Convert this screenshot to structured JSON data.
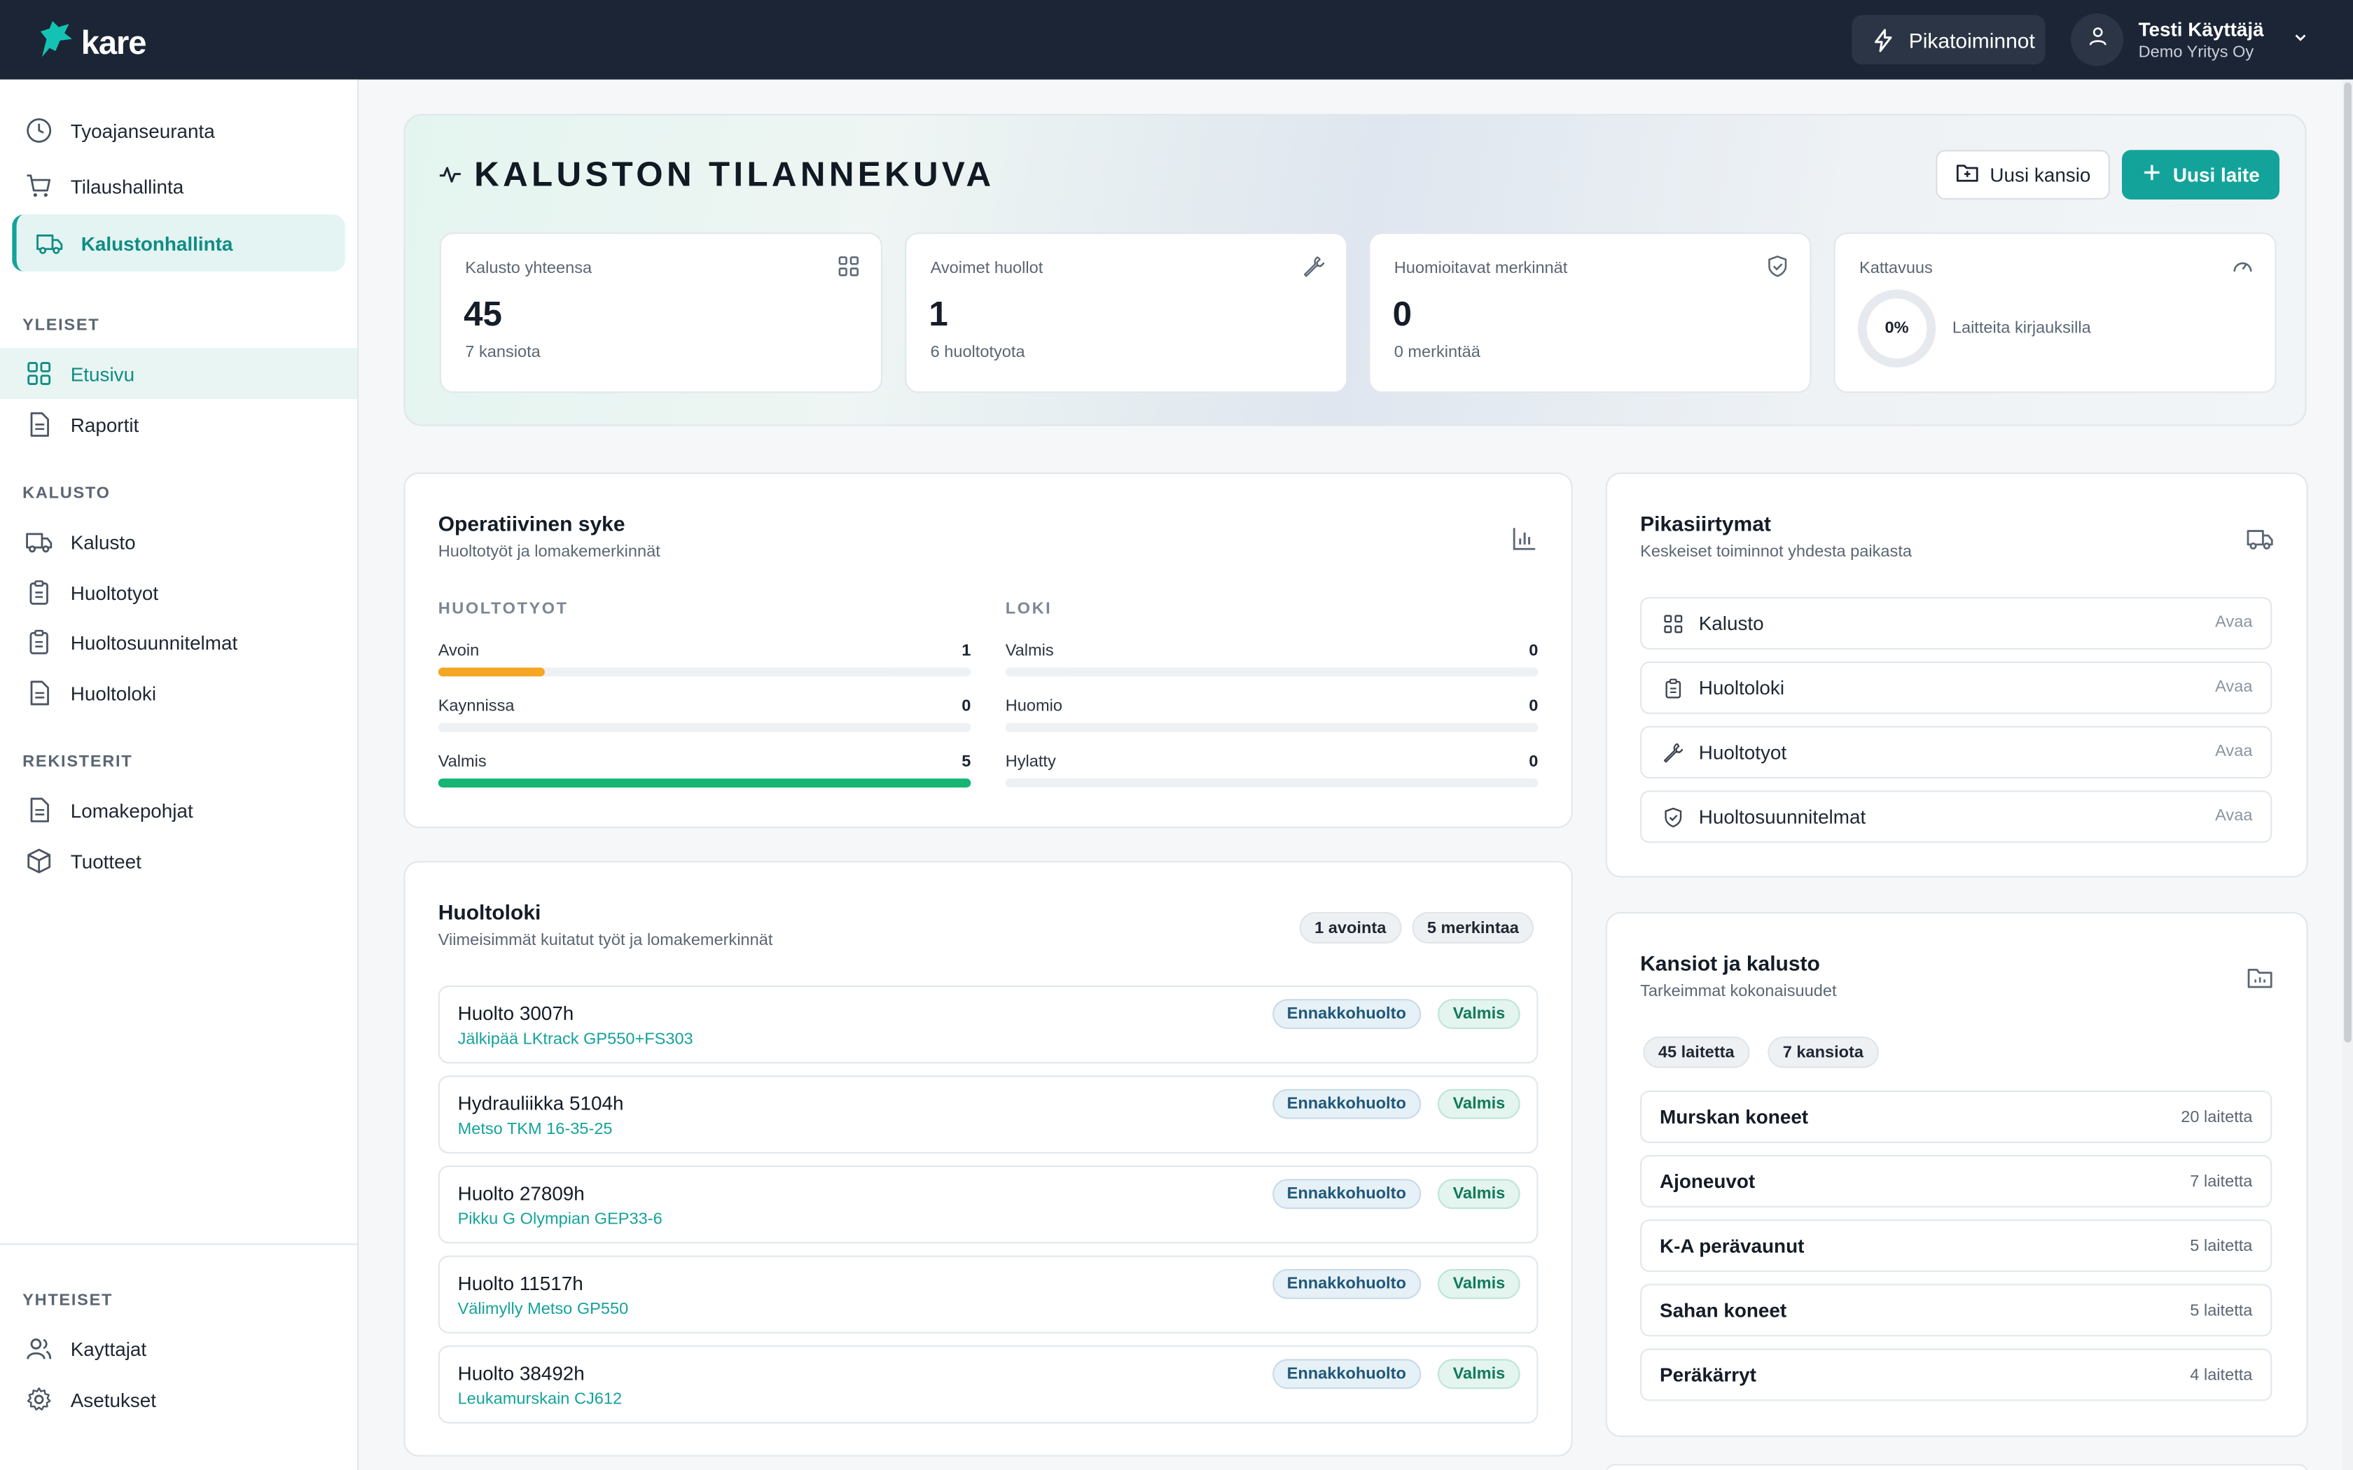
{
  "app": {
    "brand": "kare",
    "quick_actions": "Pikatoiminnot",
    "user": {
      "name": "Testi Käyttäjä",
      "org": "Demo Yritys Oy"
    }
  },
  "sidebar": {
    "top_items": [
      {
        "label": "Tyoajanseuranta",
        "icon": "clock-icon"
      },
      {
        "label": "Tilaushallinta",
        "icon": "cart-icon"
      },
      {
        "label": "Kalustonhallinta",
        "icon": "truck-icon"
      }
    ],
    "section_yleiset": "YLEISET",
    "yleiset": [
      {
        "label": "Etusivu",
        "icon": "grid-icon"
      },
      {
        "label": "Raportit",
        "icon": "document-icon"
      }
    ],
    "section_kalusto": "KALUSTO",
    "kalusto": [
      {
        "label": "Kalusto",
        "icon": "truck-icon"
      },
      {
        "label": "Huoltotyot",
        "icon": "clipboard-icon"
      },
      {
        "label": "Huoltosuunnitelmat",
        "icon": "clipboard-icon"
      },
      {
        "label": "Huoltoloki",
        "icon": "document-icon"
      }
    ],
    "section_rekisterit": "REKISTERIT",
    "rekisterit": [
      {
        "label": "Lomakepohjat",
        "icon": "document-icon"
      },
      {
        "label": "Tuotteet",
        "icon": "box-icon"
      }
    ],
    "section_yhteiset": "YHTEISET",
    "yhteiset": [
      {
        "label": "Kayttajat",
        "icon": "users-icon"
      },
      {
        "label": "Asetukset",
        "icon": "gear-icon"
      }
    ]
  },
  "hero": {
    "title": "KALUSTON TILANNEKUVA",
    "btn_folder": "Uusi kansio",
    "btn_device": "Uusi laite",
    "stats": [
      {
        "label": "Kalusto yhteensa",
        "value": "45",
        "sub": "7 kansiota"
      },
      {
        "label": "Avoimet huollot",
        "value": "1",
        "sub": "6 huoltotyota"
      },
      {
        "label": "Huomioitavat merkinnät",
        "value": "0",
        "sub": "0 merkintää"
      },
      {
        "label": "Kattavuus",
        "value": "0%",
        "sub": "Laitteita kirjauksilla",
        "percent": 0
      }
    ]
  },
  "pulse": {
    "title": "Operatiivinen syke",
    "subtitle": "Huoltotyöt ja lomakemerkinnät",
    "col1_head": "HUOLTOTYOT",
    "col1": [
      {
        "label": "Avoin",
        "value": "1",
        "fraction": 0.2,
        "color": "#f5a623"
      },
      {
        "label": "Kaynnissa",
        "value": "0",
        "fraction": 0,
        "color": "#14a39a"
      },
      {
        "label": "Valmis",
        "value": "5",
        "fraction": 1.0,
        "color": "#15b574"
      }
    ],
    "col2_head": "LOKI",
    "col2": [
      {
        "label": "Valmis",
        "value": "0",
        "fraction": 0,
        "color": "#15b574"
      },
      {
        "label": "Huomio",
        "value": "0",
        "fraction": 0,
        "color": "#f5a623"
      },
      {
        "label": "Hylatty",
        "value": "0",
        "fraction": 0,
        "color": "#e0524c"
      }
    ]
  },
  "log": {
    "title": "Huoltoloki",
    "subtitle": "Viimeisimmät kuitatut työt ja lomakemerkinnät",
    "pill_open": "1 avointa",
    "pill_entries": "5 merkintaa",
    "rows": [
      {
        "title": "Huolto 3007h",
        "device": "Jälkipää LKtrack GP550+FS303",
        "type": "Ennakkohuolto",
        "status": "Valmis"
      },
      {
        "title": "Hydrauliikka 5104h",
        "device": "Metso TKM 16-35-25",
        "type": "Ennakkohuolto",
        "status": "Valmis"
      },
      {
        "title": "Huolto 27809h",
        "device": "Pikku G Olympian GEP33-6",
        "type": "Ennakkohuolto",
        "status": "Valmis"
      },
      {
        "title": "Huolto 11517h",
        "device": "Välimylly Metso GP550",
        "type": "Ennakkohuolto",
        "status": "Valmis"
      },
      {
        "title": "Huolto 38492h",
        "device": "Leukamurskain CJ612",
        "type": "Ennakkohuolto",
        "status": "Valmis"
      }
    ]
  },
  "shortcuts": {
    "title": "Pikasiirtymat",
    "subtitle": "Keskeiset toiminnot yhdesta paikasta",
    "open_label": "Avaa",
    "items": [
      {
        "label": "Kalusto",
        "icon": "grid-icon"
      },
      {
        "label": "Huoltoloki",
        "icon": "clipboard-icon"
      },
      {
        "label": "Huoltotyot",
        "icon": "wrench-icon"
      },
      {
        "label": "Huoltosuunnitelmat",
        "icon": "shield-icon"
      }
    ]
  },
  "folders": {
    "title": "Kansiot ja kalusto",
    "subtitle": "Tarkeimmat kokonaisuudet",
    "pill_devices": "45 laitetta",
    "pill_folders": "7 kansiota",
    "items": [
      {
        "name": "Murskan koneet",
        "count": "20 laitetta"
      },
      {
        "name": "Ajoneuvot",
        "count": "7 laitetta"
      },
      {
        "name": "K-A perävaunut",
        "count": "5 laitetta"
      },
      {
        "name": "Sahan koneet",
        "count": "5 laitetta"
      },
      {
        "name": "Peräkärryt",
        "count": "4 laitetta"
      }
    ]
  },
  "colors": {
    "accent": "#14a39a",
    "topbar": "#1b2535",
    "warning": "#f5a623",
    "success": "#15b574"
  }
}
